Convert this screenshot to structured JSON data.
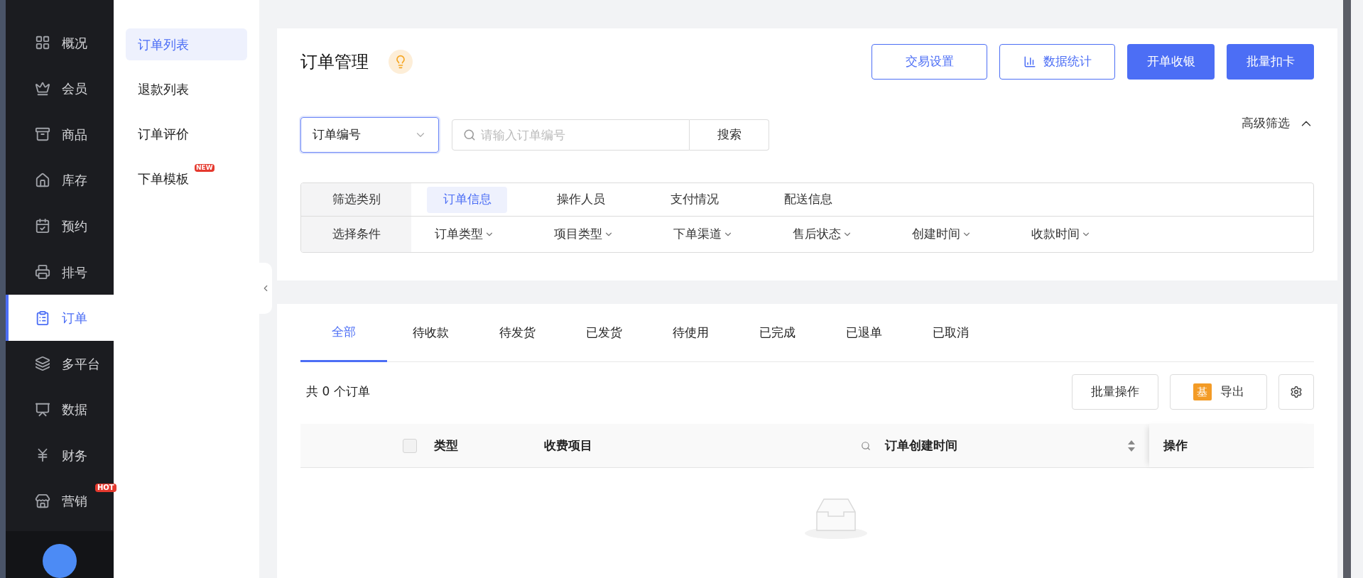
{
  "sidebar": {
    "items": [
      {
        "label": "概况",
        "selected": false
      },
      {
        "label": "会员",
        "selected": false
      },
      {
        "label": "商品",
        "selected": false
      },
      {
        "label": "库存",
        "selected": false
      },
      {
        "label": "预约",
        "selected": false
      },
      {
        "label": "排号",
        "selected": false
      },
      {
        "label": "订单",
        "selected": true
      },
      {
        "label": "多平台",
        "selected": false
      },
      {
        "label": "数据",
        "selected": false
      },
      {
        "label": "财务",
        "selected": false
      },
      {
        "label": "营销",
        "selected": false,
        "badge": "HOT"
      }
    ]
  },
  "submenu": {
    "items": [
      {
        "label": "订单列表",
        "selected": true
      },
      {
        "label": "退款列表",
        "selected": false
      },
      {
        "label": "订单评价",
        "selected": false
      },
      {
        "label": "下单模板",
        "selected": false,
        "badge": "NEW"
      }
    ]
  },
  "header": {
    "title": "订单管理",
    "buttons": [
      {
        "label": "交易设置",
        "kind": "outline"
      },
      {
        "label": "数据统计",
        "kind": "outline-icon"
      },
      {
        "label": "开单收银",
        "kind": "primary"
      },
      {
        "label": "批量扣卡",
        "kind": "primary"
      }
    ]
  },
  "search": {
    "field_select": "订单编号",
    "placeholder": "请输入订单编号",
    "button": "搜索",
    "advanced": "高级筛选",
    "advanced_expanded": true
  },
  "filters": {
    "category_label": "筛选类别",
    "categories": [
      {
        "label": "订单信息",
        "selected": true
      },
      {
        "label": "操作人员",
        "selected": false
      },
      {
        "label": "支付情况",
        "selected": false
      },
      {
        "label": "配送信息",
        "selected": false
      }
    ],
    "condition_label": "选择条件",
    "conditions": [
      "订单类型",
      "项目类型",
      "下单渠道",
      "售后状态",
      "创建时间",
      "收款时间"
    ]
  },
  "tabs": [
    {
      "label": "全部",
      "selected": true
    },
    {
      "label": "待收款",
      "selected": false
    },
    {
      "label": "待发货",
      "selected": false
    },
    {
      "label": "已发货",
      "selected": false
    },
    {
      "label": "待使用",
      "selected": false
    },
    {
      "label": "已完成",
      "selected": false
    },
    {
      "label": "已退单",
      "selected": false
    },
    {
      "label": "已取消",
      "selected": false
    }
  ],
  "count": "共 0 个订单",
  "toolbar": {
    "batch": "批量操作",
    "export_badge": "基",
    "export": "导出"
  },
  "table": {
    "select_all_checked": false,
    "columns": [
      {
        "label": "类型",
        "kind": "plain"
      },
      {
        "label": "收费项目",
        "kind": "search"
      },
      {
        "label": "订单创建时间",
        "kind": "sort"
      },
      {
        "label": "操作",
        "kind": "plain"
      }
    ]
  }
}
